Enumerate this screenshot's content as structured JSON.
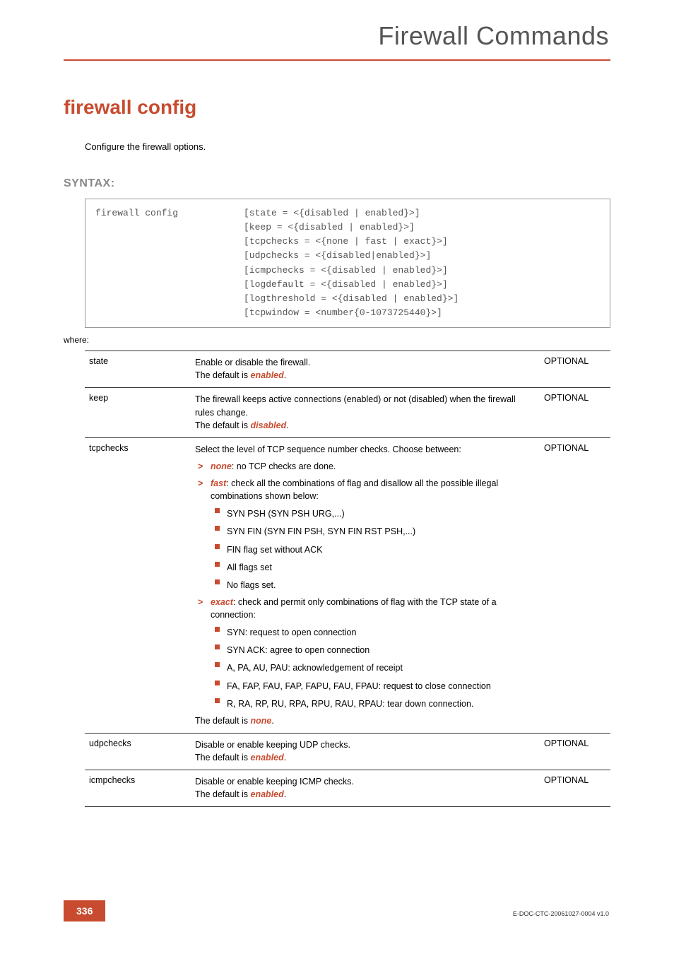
{
  "header": {
    "title": "Firewall Commands"
  },
  "title": "firewall config",
  "subtitle": "Configure the firewall options.",
  "syntax_label": "SYNTAX:",
  "syntax": {
    "command": "firewall config",
    "lines": [
      "[state = <{disabled | enabled}>]",
      "[keep = <{disabled | enabled}>]",
      "[tcpchecks = <{none | fast | exact}>]",
      "[udpchecks = <{disabled|enabled}>]",
      "[icmpchecks = <{disabled | enabled}>]",
      "[logdefault = <{disabled | enabled}>]",
      "[logthreshold = <{disabled | enabled}>]",
      "[tcpwindow = <number{0-1073725440}>]"
    ]
  },
  "where_label": "where:",
  "params": {
    "state": {
      "name": "state",
      "desc": "Enable or disable the firewall.",
      "default_prefix": "The default is ",
      "default_value": "enabled",
      "default_suffix": ".",
      "req": "OPTIONAL"
    },
    "keep": {
      "name": "keep",
      "desc": "The firewall keeps active connections (enabled) or not (disabled) when the firewall rules change.",
      "default_prefix": "The default is ",
      "default_value": "disabled",
      "default_suffix": ".",
      "req": "OPTIONAL"
    },
    "tcpchecks": {
      "name": "tcpchecks",
      "intro": "Select the level of TCP sequence number checks. Choose between:",
      "none": {
        "term": "none",
        "text": ": no TCP checks are done."
      },
      "fast": {
        "term": "fast",
        "text": ": check all the combinations of flag and disallow all the possible illegal combinations shown below:",
        "bullets": [
          "SYN PSH (SYN PSH URG,...)",
          "SYN FIN (SYN FIN PSH, SYN FIN RST PSH,...)",
          "FIN flag set without ACK",
          "All flags set",
          "No flags set."
        ]
      },
      "exact": {
        "term": "exact",
        "text": ": check and permit only combinations of flag with the TCP state of a connection:",
        "bullets": [
          "SYN: request to open connection",
          "SYN ACK: agree to open connection",
          "A, PA, AU, PAU: acknowledgement of receipt",
          "FA, FAP, FAU, FAP, FAPU, FAU, FPAU: request to close connection",
          "R, RA, RP, RU, RPA, RPU, RAU, RPAU: tear down connection."
        ]
      },
      "default_prefix": "The default is ",
      "default_value": "none",
      "default_suffix": ".",
      "req": "OPTIONAL"
    },
    "udpchecks": {
      "name": "udpchecks",
      "desc": "Disable or enable keeping UDP checks.",
      "default_prefix": "The default is ",
      "default_value": "enabled",
      "default_suffix": ".",
      "req": "OPTIONAL"
    },
    "icmpchecks": {
      "name": "icmpchecks",
      "desc": "Disable or enable keeping ICMP checks.",
      "default_prefix": "The default is ",
      "default_value": "enabled",
      "default_suffix": ".",
      "req": "OPTIONAL"
    }
  },
  "footer": {
    "page": "336",
    "docid": "E-DOC-CTC-20061027-0004 v1.0"
  }
}
